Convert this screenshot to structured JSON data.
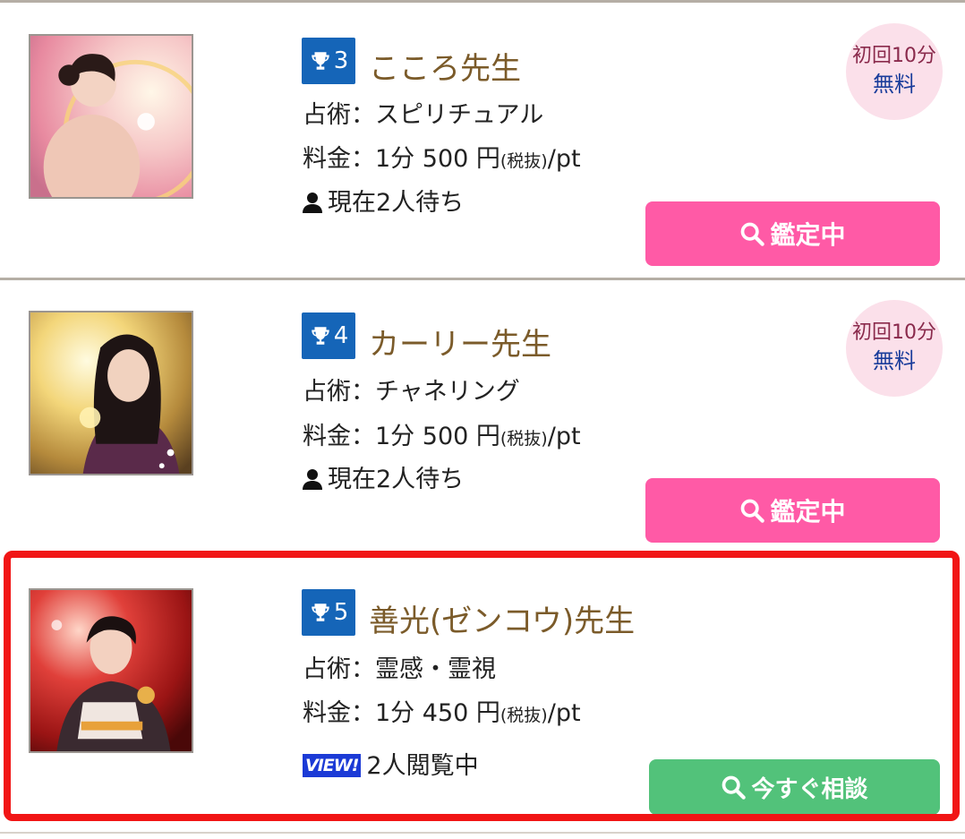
{
  "cards": [
    {
      "rank": "3",
      "name": "こころ先生",
      "divination": "占術：スピリチュアル",
      "fee_prefix": "料金：1分 500 円",
      "fee_tax": "(税抜)",
      "fee_suffix": "/pt",
      "status_text": "現在2人待ち",
      "badge_top": "初回10分",
      "badge_bottom": "無料",
      "button_label": "鑑定中",
      "button_color": "#ff5aa6"
    },
    {
      "rank": "4",
      "name": "カーリー先生",
      "divination": "占術：チャネリング",
      "fee_prefix": "料金：1分 500 円",
      "fee_tax": "(税抜)",
      "fee_suffix": "/pt",
      "status_text": "現在2人待ち",
      "badge_top": "初回10分",
      "badge_bottom": "無料",
      "button_label": "鑑定中",
      "button_color": "#ff5aa6"
    },
    {
      "rank": "5",
      "name": "善光(ゼンコウ)先生",
      "divination": "占術：霊感・霊視",
      "fee_prefix": "料金：1分 450 円",
      "fee_tax": "(税抜)",
      "fee_suffix": "/pt",
      "view_badge": "VIEW!",
      "status_text": "2人閲覧中",
      "button_label": "今すぐ相談",
      "button_color": "#52c27a",
      "highlighted": true
    }
  ],
  "colors": {
    "rank_badge": "#1565b8",
    "name_text": "#7b5b2a",
    "free_badge_bg": "#fbe0ea",
    "highlight_border": "#f11515"
  },
  "icons": [
    "trophy-icon",
    "person-icon",
    "search-icon",
    "view-badge"
  ]
}
